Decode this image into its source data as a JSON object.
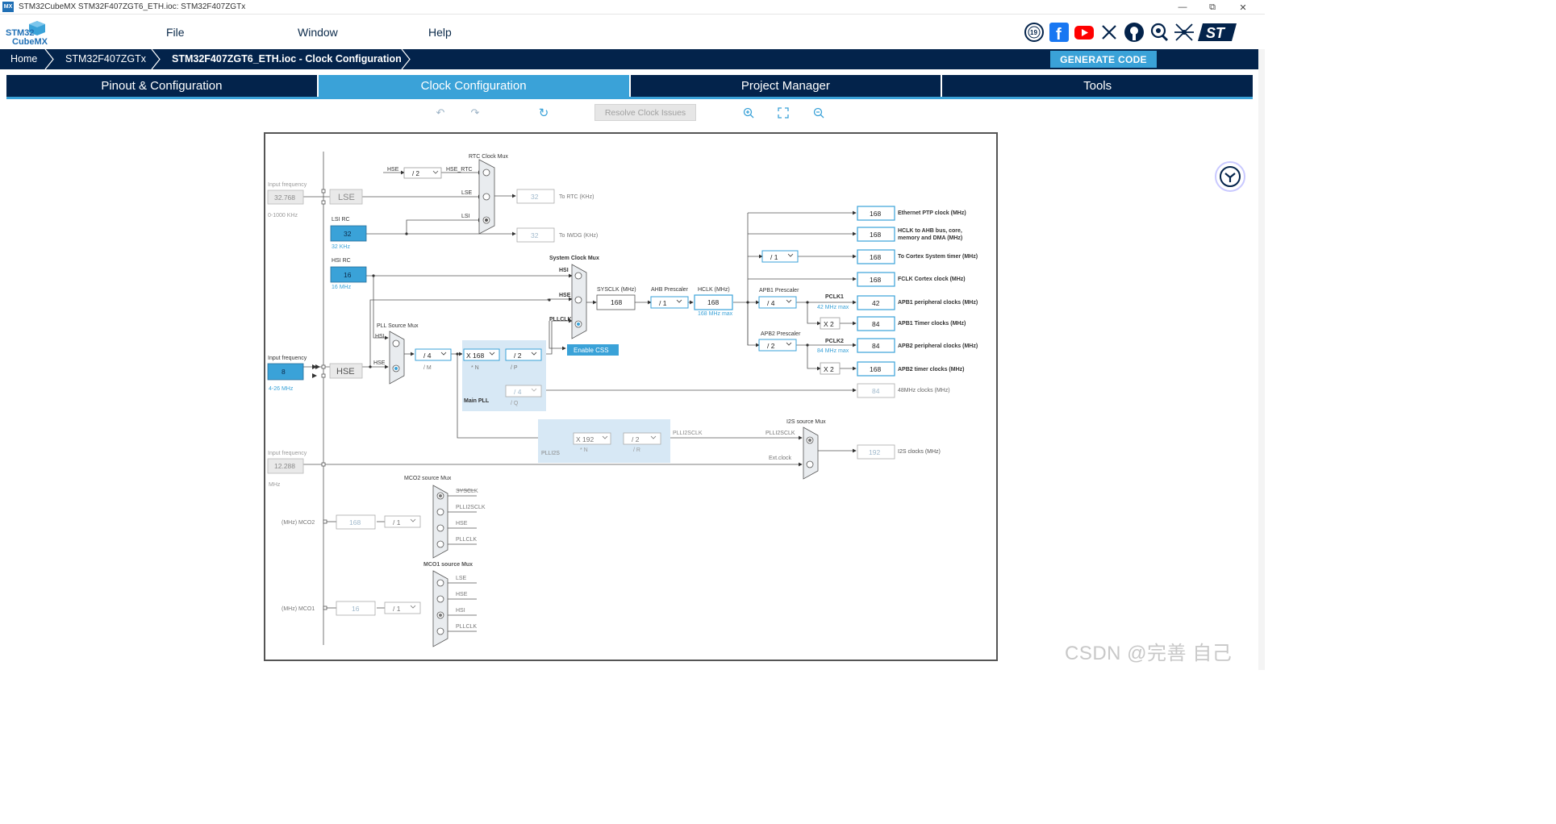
{
  "window": {
    "badge": "MX",
    "title": "STM32CubeMX STM32F407ZGT6_ETH.ioc: STM32F407ZGTx"
  },
  "logo": {
    "line1": "STM32",
    "line2": "CubeMX"
  },
  "menu": {
    "file": "File",
    "window": "Window",
    "help": "Help"
  },
  "social": [
    "anniversary-badge-icon",
    "facebook-icon",
    "youtube-icon",
    "x-icon",
    "github-icon",
    "community-icon",
    "network-icon",
    "st-logo-icon"
  ],
  "breadcrumb": {
    "home": "Home",
    "device": "STM32F407ZGTx",
    "current": "STM32F407ZGT6_ETH.ioc - Clock Configuration"
  },
  "generate_label": "GENERATE CODE",
  "tabs": [
    {
      "label": "Pinout & Configuration"
    },
    {
      "label": "Clock Configuration"
    },
    {
      "label": "Project Manager"
    },
    {
      "label": "Tools"
    }
  ],
  "toolbar": {
    "resolve_label": "Resolve Clock Issues"
  },
  "watermark": "CSDN @完善 自己",
  "clock": {
    "inputs": {
      "input_frequency_label": "Input frequency",
      "lse_freq": "32.768",
      "lse_range": "0-1000 KHz",
      "lse_label": "LSE",
      "lsi_title": "LSI RC",
      "lsi_value": "32",
      "lsi_unit": "32 KHz",
      "hsi_title": "HSI RC",
      "hsi_value": "16",
      "hsi_unit": "16 MHz",
      "hse_freq": "8",
      "hse_range": "4-26 MHz",
      "hse_label": "HSE",
      "i2s_ext_freq": "12.288",
      "i2s_ext_unit": "MHz"
    },
    "rtc": {
      "mux_title": "RTC Clock Mux",
      "hse_in": "HSE",
      "div": "/ 2",
      "hse_rtc": "HSE_RTC",
      "lse_in": "LSE",
      "lsi_in": "LSI",
      "rtc_value": "32",
      "rtc_label": "To RTC (KHz)",
      "iwdg_value": "32",
      "iwdg_label": "To IWDG (KHz)"
    },
    "pll": {
      "src_mux_title": "PLL Source Mux",
      "hsi": "HSI",
      "hse": "HSE",
      "m": "/ 4",
      "m_label": "/ M",
      "n": "X 168",
      "n_label": "* N",
      "p": "/ 2",
      "p_label": "/ P",
      "q": "/ 4",
      "q_label": "/ Q",
      "main_label": "Main PLL"
    },
    "plli2s": {
      "label": "PLLI2S",
      "n": "X 192",
      "n_label": "* N",
      "r": "/ 2",
      "r_label": "/ R",
      "out_label": "PLLI2SCLK",
      "mux_title": "I2S source Mux",
      "mux_in1": "PLLI2SCLK",
      "mux_in2": "Ext.clock",
      "i2s_value": "192",
      "i2s_label": "I2S clocks (MHz)"
    },
    "sys": {
      "mux_title": "System Clock Mux",
      "hsi": "HSI",
      "hse": "HSE",
      "pllclk": "PLLCLK",
      "css_label": "Enable CSS",
      "sysclk_title": "SYSCLK (MHz)",
      "sysclk": "168",
      "ahb_title": "AHB Prescaler",
      "ahb": "/ 1",
      "hclk_title": "HCLK (MHz)",
      "hclk": "168",
      "hclk_max": "168 MHz max",
      "apb1_title": "APB1 Prescaler",
      "apb1": "/ 4",
      "pclk1": "PCLK1",
      "pclk1_max": "42 MHz max",
      "apb2_title": "APB2 Prescaler",
      "apb2": "/ 2",
      "pclk2": "PCLK2",
      "pclk2_max": "84 MHz max",
      "cortex_div": "/ 1",
      "x2a": "X 2",
      "x2b": "X 2"
    },
    "outputs": [
      {
        "value": "168",
        "label": "Ethernet PTP clock (MHz)"
      },
      {
        "value": "168",
        "label": "HCLK to AHB bus, core,",
        "label2": "memory and DMA (MHz)"
      },
      {
        "value": "168",
        "label": "To Cortex System timer (MHz)"
      },
      {
        "value": "168",
        "label": "FCLK Cortex clock (MHz)"
      },
      {
        "value": "42",
        "label": "APB1 peripheral clocks (MHz)"
      },
      {
        "value": "84",
        "label": "APB1 Timer clocks (MHz)"
      },
      {
        "value": "84",
        "label": "APB2 peripheral clocks (MHz)"
      },
      {
        "value": "168",
        "label": "APB2 timer clocks (MHz)"
      },
      {
        "value": "84",
        "label": "48MHz clocks (MHz)"
      }
    ],
    "mco2": {
      "title": "MCO2 source Mux",
      "inputs": [
        "SYSCLK",
        "PLLI2SCLK",
        "HSE",
        "PLLCLK"
      ],
      "div": "/ 1",
      "value": "168",
      "label": "(MHz) MCO2"
    },
    "mco1": {
      "title": "MCO1 source Mux",
      "inputs": [
        "LSE",
        "HSE",
        "HSI",
        "PLLCLK"
      ],
      "div": "/ 1",
      "value": "16",
      "label": "(MHz) MCO1"
    }
  }
}
